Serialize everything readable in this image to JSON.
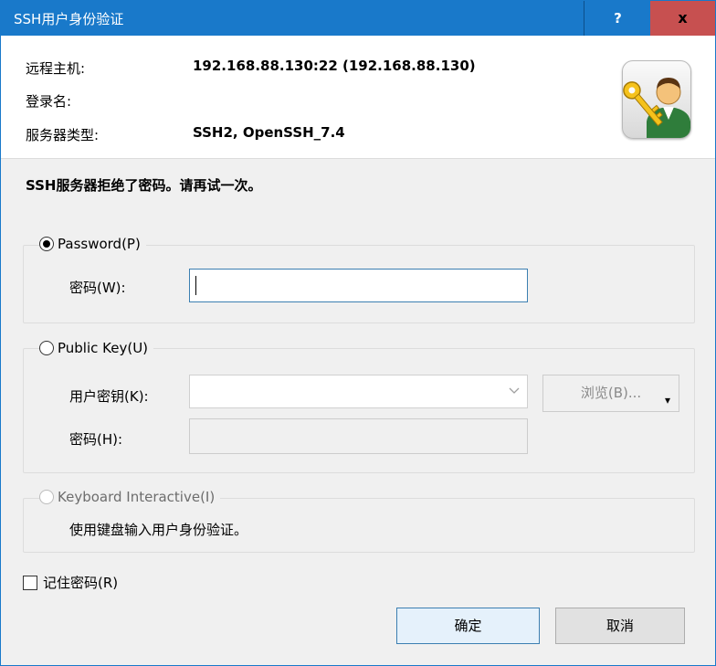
{
  "window": {
    "title": "SSH用户身份验证",
    "help_label": "?",
    "close_label": "x"
  },
  "info": {
    "remote_host_label": "远程主机:",
    "remote_host_value": "192.168.88.130:22 (192.168.88.130)",
    "login_name_label": "登录名:",
    "login_name_value": "",
    "server_type_label": "服务器类型:",
    "server_type_value": "SSH2, OpenSSH_7.4",
    "icon": "key-user-icon"
  },
  "message": "SSH服务器拒绝了密码。请再试一次。",
  "password_group": {
    "radio_label": "Password(P)",
    "selected": true,
    "password_label": "密码(W):",
    "password_value": ""
  },
  "public_key_group": {
    "radio_label": "Public Key(U)",
    "selected": false,
    "user_key_label": "用户密钥(K):",
    "user_key_value": "",
    "browse_label": "浏览(B)...",
    "passphrase_label": "密码(H):",
    "passphrase_value": ""
  },
  "keyboard_group": {
    "radio_label": "Keyboard Interactive(I)",
    "selected": false,
    "description": "使用键盘输入用户身份验证。"
  },
  "remember": {
    "label": "记住密码(R)",
    "checked": false
  },
  "buttons": {
    "ok_label": "确定",
    "cancel_label": "取消"
  },
  "colors": {
    "titlebar": "#1979ca",
    "close_button": "#c75050",
    "dialog_background": "#f0f0f0"
  }
}
